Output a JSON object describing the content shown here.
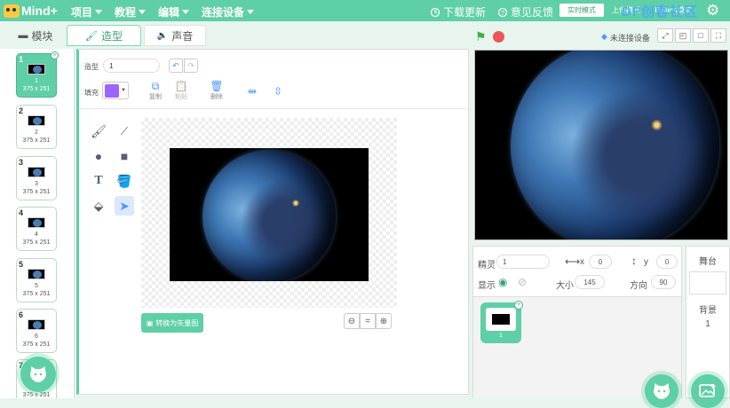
{
  "app": {
    "logo_text": "Mind+"
  },
  "menu": [
    {
      "label": "项目"
    },
    {
      "label": "教程"
    },
    {
      "label": "编辑"
    },
    {
      "label": "连接设备"
    }
  ],
  "topbar_right": {
    "update_label": "下载更新",
    "feedback_label": "意见反馈",
    "mode_realtime": "实时模式",
    "mode_upload": "上传模式",
    "mode_python": "Python模式",
    "watermark": "DF创客社区"
  },
  "tabs": {
    "blocks": "模块",
    "costumes": "造型",
    "sounds": "声音"
  },
  "costumes": [
    {
      "num": "1",
      "name": "1",
      "size": "375 x 251",
      "selected": true
    },
    {
      "num": "2",
      "name": "2",
      "size": "375 x 251",
      "selected": false
    },
    {
      "num": "3",
      "name": "3",
      "size": "375 x 251",
      "selected": false
    },
    {
      "num": "4",
      "name": "4",
      "size": "375 x 251",
      "selected": false
    },
    {
      "num": "5",
      "name": "5",
      "size": "375 x 251",
      "selected": false
    },
    {
      "num": "6",
      "name": "6",
      "size": "375 x 251",
      "selected": false
    },
    {
      "num": "7",
      "name": "",
      "size": "375 x 251",
      "selected": false
    }
  ],
  "editor": {
    "costume_label": "造型",
    "costume_name": "1",
    "fill_label": "填充",
    "fill_color": "#9966ff",
    "copy_label": "复制",
    "paste_label": "粘贴",
    "delete_label": "删除",
    "convert_label": "转换为矢量图",
    "zoom_reset": "="
  },
  "stage_ctrl": {
    "unconnected": "未连接设备"
  },
  "sprite": {
    "sprite_label": "精灵",
    "sprite_name": "1",
    "x_label": "x",
    "x_value": "0",
    "y_label": "y",
    "y_value": "0",
    "show_label": "显示",
    "size_label": "大小",
    "size_value": "145",
    "direction_label": "方向",
    "direction_value": "90",
    "card_name": "1"
  },
  "stage_panel": {
    "title": "舞台",
    "backdrop_label": "背景",
    "backdrop_count": "1"
  },
  "colors": {
    "accent": "#5ecfa6",
    "accent_dark": "#3c9f7a",
    "blue": "#4c97ff",
    "stop": "#ee5555",
    "flag": "#3cb043"
  }
}
